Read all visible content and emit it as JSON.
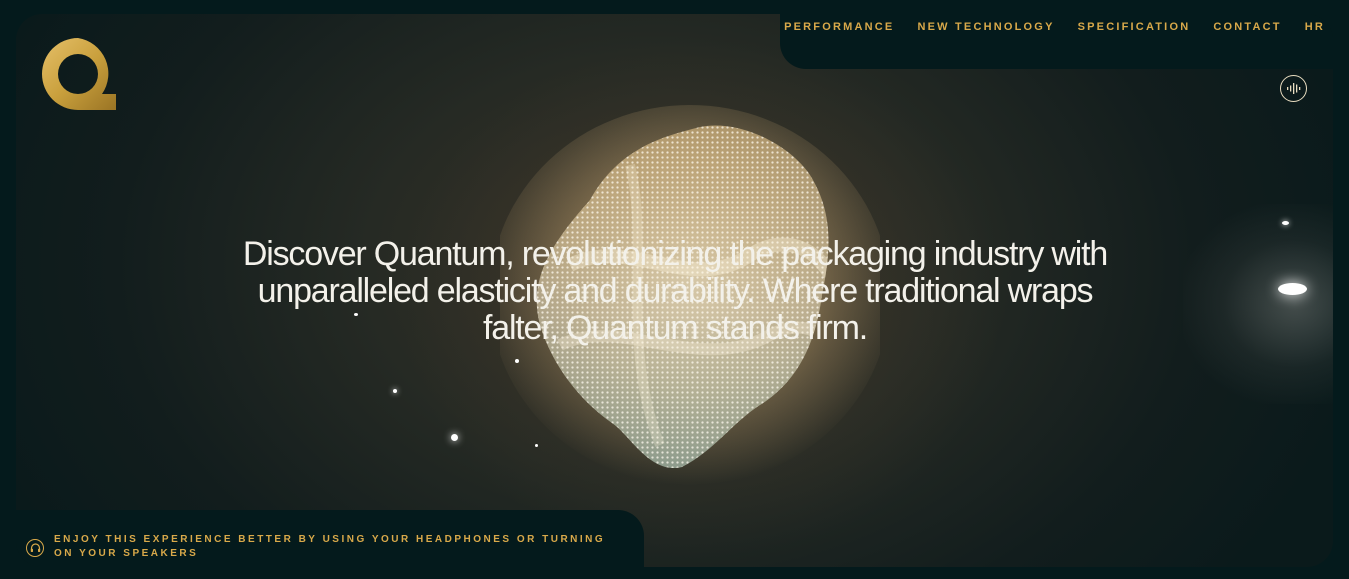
{
  "nav": {
    "items": [
      {
        "label": "PERFORMANCE"
      },
      {
        "label": "NEW TECHNOLOGY"
      },
      {
        "label": "SPECIFICATION"
      },
      {
        "label": "CONTACT"
      },
      {
        "label": "HR"
      }
    ]
  },
  "logo": {
    "icon": "quantum-q-logo",
    "color": "#c9a03d"
  },
  "sound_toggle": {
    "icon": "sound-wave-icon"
  },
  "hero": {
    "headline": "Discover Quantum, revolutionizing the packaging industry with unparalleled elasticity and durability. Where traditional wraps falter, Quantum stands firm."
  },
  "footer_note": {
    "icon": "headphones-icon",
    "text": "ENJOY THIS EXPERIENCE BETTER BY USING YOUR HEADPHONES OR TURNING ON YOUR SPEAKERS"
  },
  "colors": {
    "background": "#041a1c",
    "accent_gold": "#d9a94a",
    "headline": "#f3f1ea"
  }
}
